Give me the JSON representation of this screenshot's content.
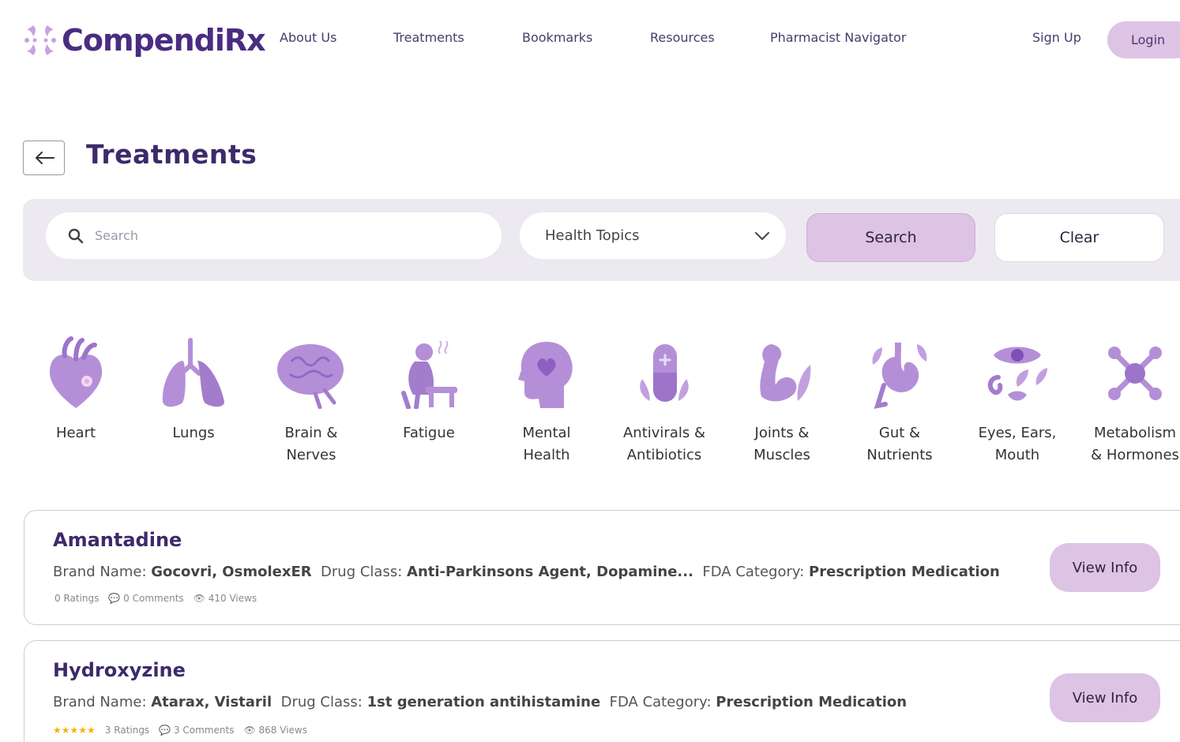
{
  "brand": {
    "name": "CompendiRx"
  },
  "nav": {
    "links": [
      "About Us",
      "Treatments",
      "Bookmarks",
      "Resources",
      "Pharmacist Navigator"
    ],
    "sign_up": "Sign Up",
    "login": "Login"
  },
  "page": {
    "title": "Treatments"
  },
  "search": {
    "placeholder": "Search",
    "topic_selected": "Health Topics",
    "search_label": "Search",
    "clear_label": "Clear"
  },
  "categories": [
    {
      "label": "Heart",
      "icon": "heart-icon"
    },
    {
      "label": "Lungs",
      "icon": "lungs-icon"
    },
    {
      "label": "Brain &\nNerves",
      "icon": "brain-icon"
    },
    {
      "label": "Fatigue",
      "icon": "fatigue-icon"
    },
    {
      "label": "Mental\nHealth",
      "icon": "mental-health-icon"
    },
    {
      "label": "Antivirals &\nAntibiotics",
      "icon": "pill-icon"
    },
    {
      "label": "Joints &\nMuscles",
      "icon": "muscle-icon"
    },
    {
      "label": "Gut &\nNutrients",
      "icon": "stomach-icon"
    },
    {
      "label": "Eyes, Ears,\nMouth",
      "icon": "eye-ear-mouth-icon"
    },
    {
      "label": "Metabolism\n& Hormones",
      "icon": "molecule-icon"
    }
  ],
  "results": [
    {
      "name": "Amantadine",
      "brand_label": "Brand Name:",
      "brand": "Gocovri, OsmolexER",
      "class_label": "Drug Class:",
      "drug_class": "Anti-Parkinsons Agent, Dopamine...",
      "fda_label": "FDA Category:",
      "fda": "Prescription Medication",
      "ratings": "0 Ratings",
      "comments": "0 Comments",
      "views": "410 Views",
      "stars": 0,
      "button": "View Info"
    },
    {
      "name": "Hydroxyzine",
      "brand_label": "Brand Name:",
      "brand": "Atarax, Vistaril",
      "class_label": "Drug Class:",
      "drug_class": "1st generation antihistamine",
      "fda_label": "FDA Category:",
      "fda": "Prescription Medication",
      "ratings": "3 Ratings",
      "comments": "3 Comments",
      "views": "868 Views",
      "stars": 5,
      "button": "View Info"
    }
  ],
  "colors": {
    "brand_purple": "#4a2c82",
    "accent_lilac": "#ddc3e4",
    "icon_purple": "#b48fd8",
    "panel_gray": "#eceaf0",
    "star_gold": "#f4b400"
  }
}
